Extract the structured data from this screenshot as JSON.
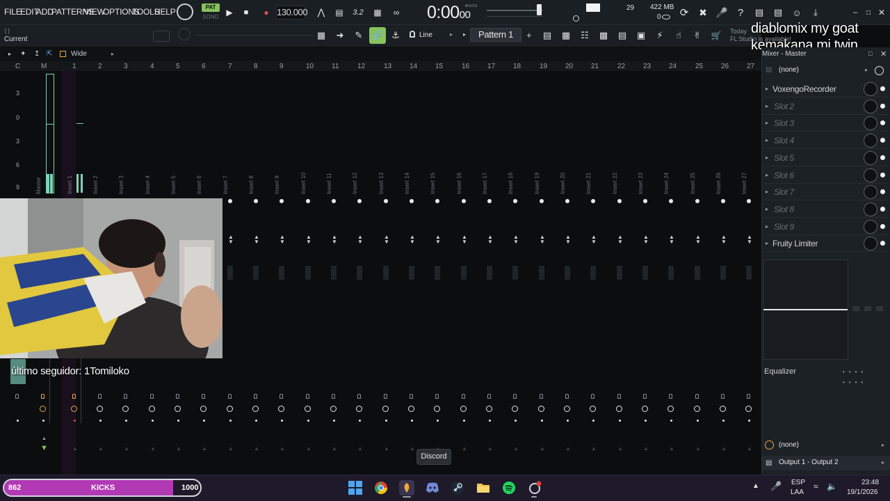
{
  "menu": {
    "file": "FILE",
    "edit": "EDIT",
    "add": "ADD",
    "patterns": "PATTERNS",
    "view": "VIEW",
    "options": "OPTIONS",
    "tools": "TOOLS",
    "help": "HELP"
  },
  "transport": {
    "pat_label": "PAT",
    "song_label": "SONG",
    "tempo": "130.000",
    "time_main": "0:00",
    "time_sub": "00",
    "time_units": "M:S:CS"
  },
  "monitors": {
    "cpu": "29",
    "memory": "422 MB",
    "polyphony": "0"
  },
  "toolbar2": {
    "hint_bracket": "[ ]",
    "hint_title": "Current",
    "snap_mode": "Line",
    "pattern": "Pattern 1",
    "pattern_add": "+",
    "news_today": "Today",
    "news_text": "FL Studio is available!"
  },
  "overlay": {
    "line1": "diablomix my goat",
    "line2": "kemakana mi twin"
  },
  "mixer": {
    "stereo_mode": "Wide",
    "track_numbers": [
      "C",
      "M",
      "1",
      "2",
      "3",
      "4",
      "5",
      "6",
      "7",
      "8",
      "9",
      "10",
      "11",
      "12",
      "13",
      "14",
      "15",
      "16",
      "17",
      "18",
      "19",
      "20",
      "21",
      "22",
      "23",
      "24",
      "25",
      "26",
      "27"
    ],
    "track_names": [
      "Master",
      "Insert 1",
      "Insert 2",
      "Insert 3",
      "Insert 4",
      "Insert 5",
      "Insert 6",
      "Insert 7",
      "Insert 8",
      "Insert 9",
      "Insert 10",
      "Insert 11",
      "Insert 12",
      "Insert 13",
      "Insert 14",
      "Insert 15",
      "Insert 16",
      "Insert 17",
      "Insert 18",
      "Insert 19",
      "Insert 20",
      "Insert 21",
      "Insert 22",
      "Insert 23",
      "Insert 24",
      "Insert 25",
      "Insert 26",
      "Insert 27"
    ],
    "db_scale": [
      "3",
      "0",
      "3",
      "6",
      "9"
    ]
  },
  "stream": {
    "follower": "último seguidor: 1Tomiloko"
  },
  "mixer_panel": {
    "title": "Mixer - Master",
    "input": "(none)",
    "slots": [
      {
        "name": "VoxengoRecorder",
        "active": true
      },
      {
        "name": "Slot 2",
        "active": false
      },
      {
        "name": "Slot 3",
        "active": false
      },
      {
        "name": "Slot 4",
        "active": false
      },
      {
        "name": "Slot 5",
        "active": false
      },
      {
        "name": "Slot 6",
        "active": false
      },
      {
        "name": "Slot 7",
        "active": false
      },
      {
        "name": "Slot 8",
        "active": false
      },
      {
        "name": "Slot 9",
        "active": false
      },
      {
        "name": "Fruity Limiter",
        "active": true
      }
    ],
    "equalizer": "Equalizer",
    "output_none": "(none)",
    "output": "Output 1 - Output 2"
  },
  "tooltip": "Discord",
  "goal_bar": {
    "current": "862",
    "label": "KICKS",
    "goal": "1000",
    "progress": 0.862,
    "fill_color": "#b13ab4"
  },
  "taskbar": {
    "icons": [
      "windows-start-icon",
      "chrome-icon",
      "fl-studio-icon",
      "discord-icon",
      "steam-icon",
      "file-explorer-icon",
      "spotify-icon",
      "app-icon"
    ],
    "lang1": "ESP",
    "lang2": "LAA",
    "time": "23:48",
    "date": "19/1/2026"
  },
  "colors": {
    "accent_green": "#86c35b",
    "meter": "#7fd3b9",
    "record": "#e14a52",
    "knob_orange": "#f2a73b"
  }
}
